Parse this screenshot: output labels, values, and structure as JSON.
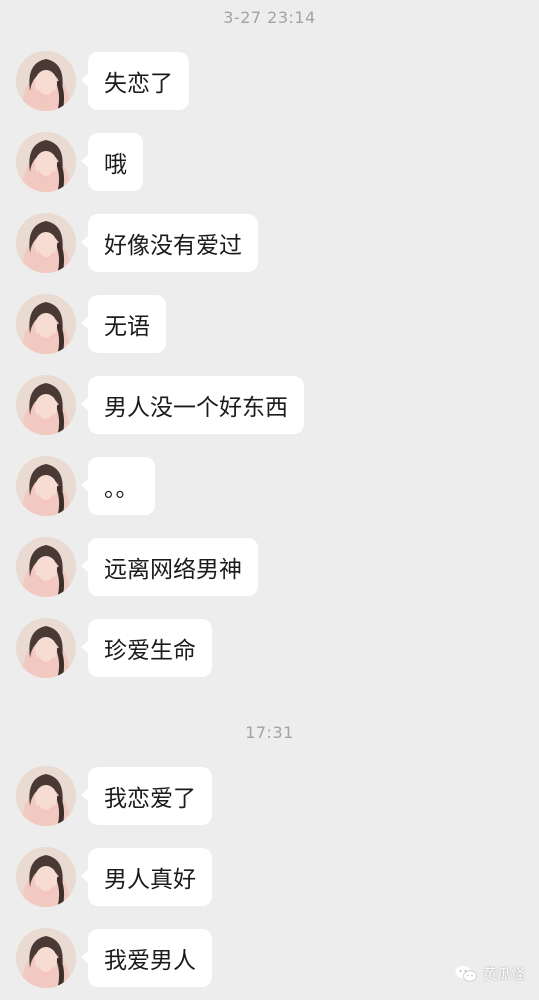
{
  "timestamps": [
    "3-27 23:14",
    "17:31"
  ],
  "messages": [
    {
      "text": "失恋了"
    },
    {
      "text": "哦"
    },
    {
      "text": "好像没有爱过"
    },
    {
      "text": "无语"
    },
    {
      "text": "男人没一个好东西"
    },
    {
      "text": "。。"
    },
    {
      "text": "远离网络男神"
    },
    {
      "text": "珍爱生命"
    },
    {
      "text": "我恋爱了"
    },
    {
      "text": "男人真好"
    },
    {
      "text": "我爱男人"
    }
  ],
  "watermark": {
    "label": "黄瓜怪",
    "icon": "wechat-icon"
  },
  "colors": {
    "background": "#ededed",
    "bubble": "#ffffff",
    "timestamp": "#a3a3a3"
  }
}
